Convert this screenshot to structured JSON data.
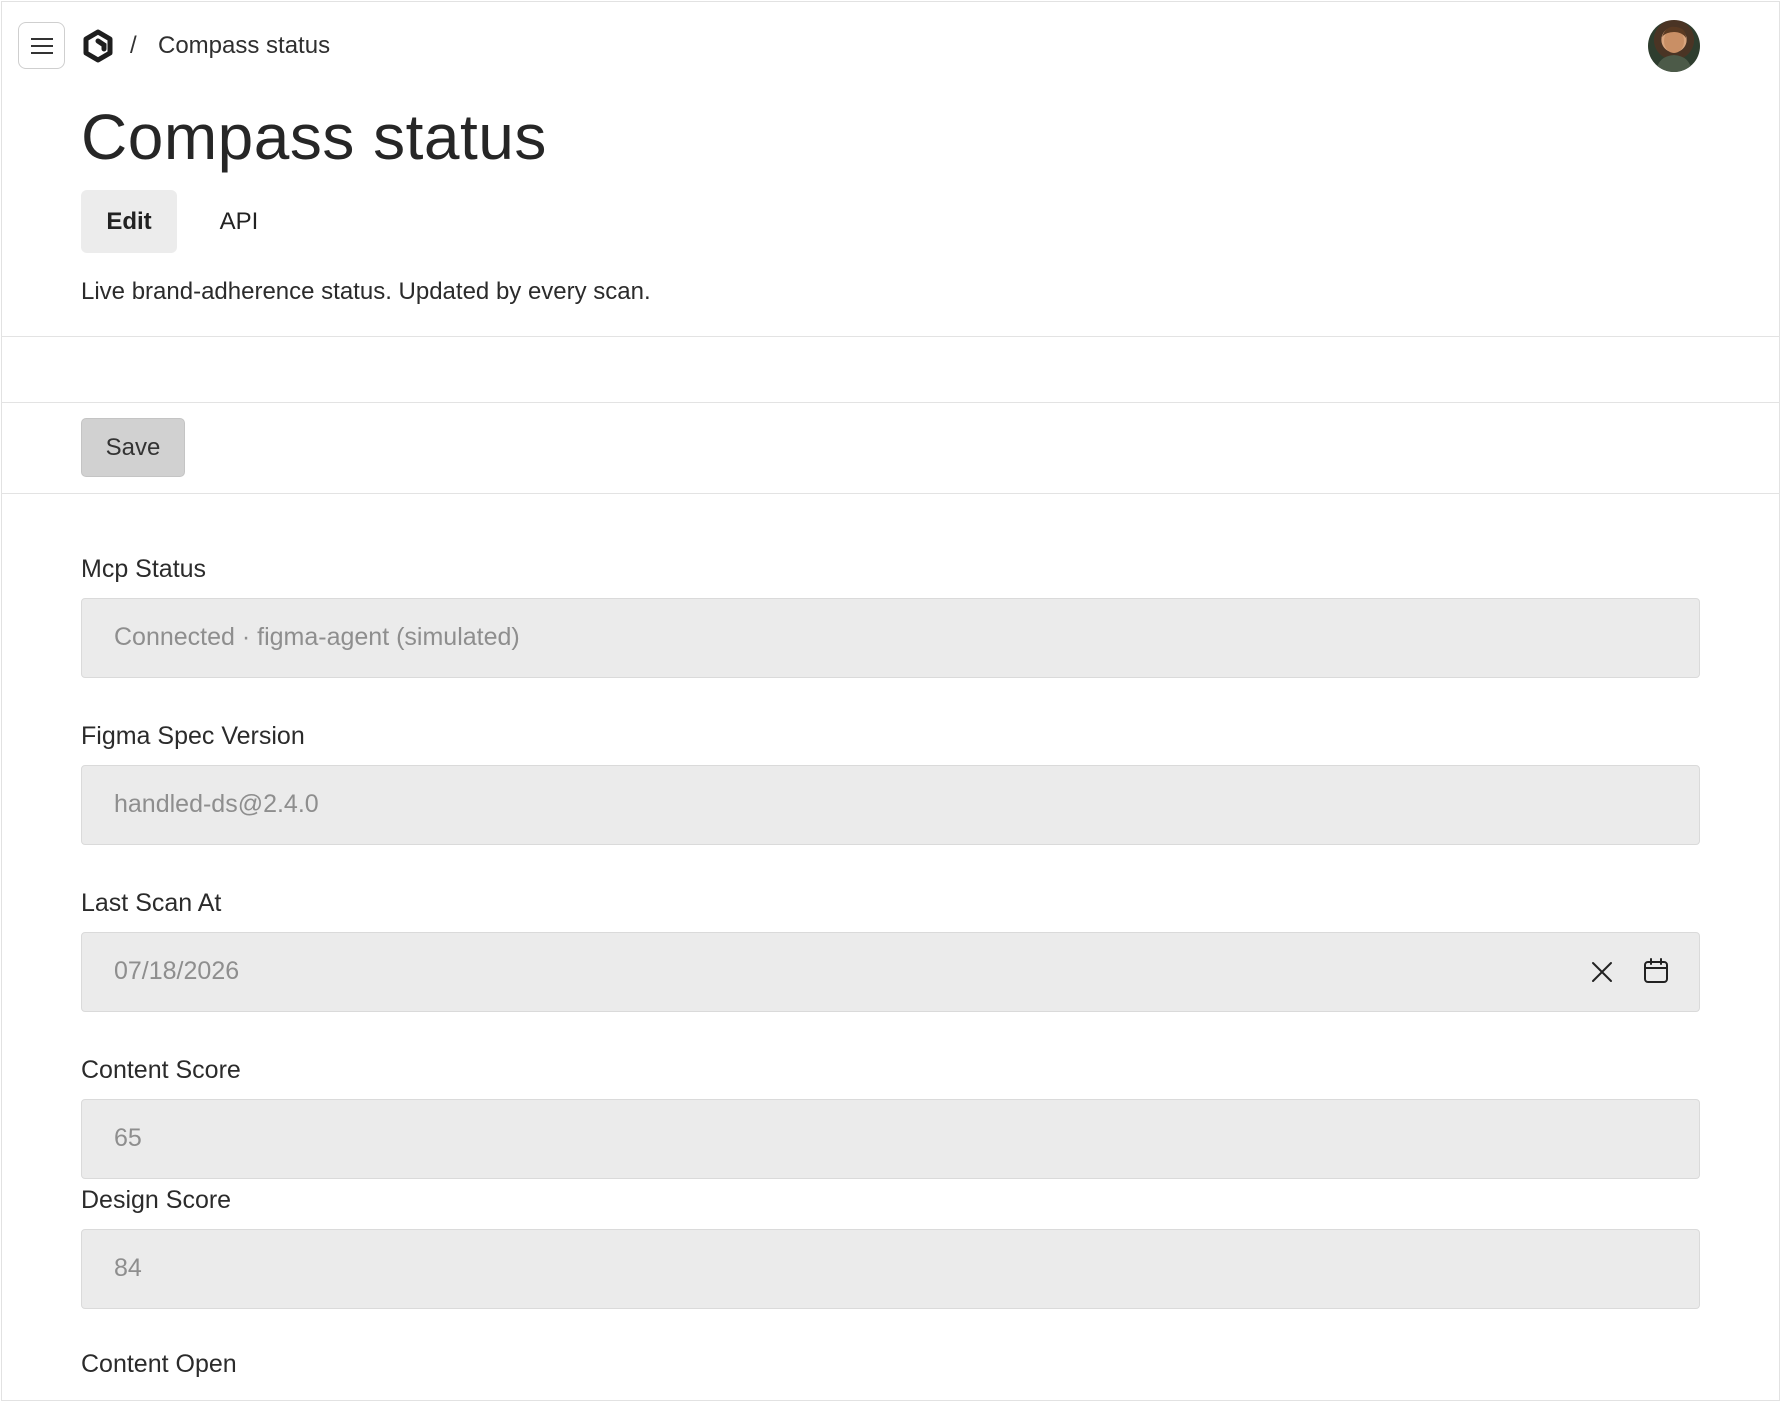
{
  "header": {
    "menu_icon": "hamburger-icon",
    "logo_icon": "hexagon-logo-icon",
    "breadcrumb_separator": "/",
    "breadcrumb_title": "Compass status",
    "avatar_icon": "user-avatar"
  },
  "page": {
    "title": "Compass status",
    "tabs": [
      {
        "label": "Edit",
        "active": true
      },
      {
        "label": "API",
        "active": false
      }
    ],
    "description": "Live brand-adherence status. Updated by every scan."
  },
  "toolbar": {
    "save_label": "Save"
  },
  "form": {
    "fields": [
      {
        "label": "Mcp Status",
        "value": "Connected · figma-agent (simulated)"
      },
      {
        "label": "Figma Spec Version",
        "value": "handled-ds@2.4.0"
      },
      {
        "label": "Last Scan At",
        "value": "07/18/2026",
        "icons": [
          "close-icon",
          "calendar-icon"
        ]
      },
      {
        "label": "Content Score",
        "value": "65"
      },
      {
        "label": "Design Score",
        "value": "84"
      },
      {
        "label": "Content Open",
        "value": ""
      }
    ]
  }
}
